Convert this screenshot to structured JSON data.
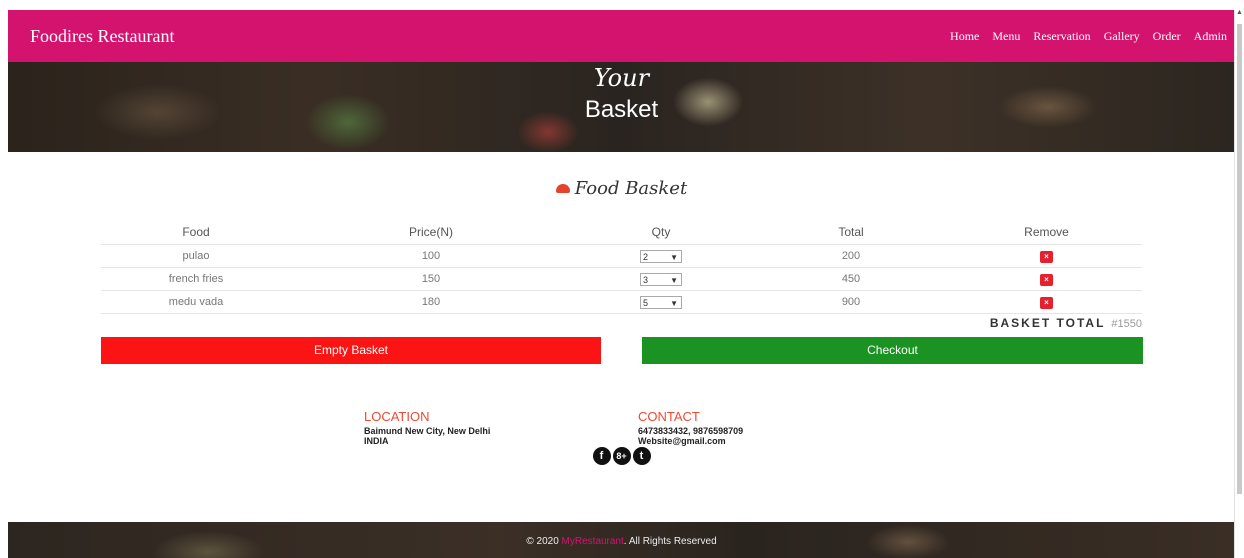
{
  "navbar": {
    "brand": "Foodires Restaurant",
    "links": [
      "Home",
      "Menu",
      "Reservation",
      "Gallery",
      "Order",
      "Admin"
    ],
    "background": "#d4136f"
  },
  "hero": {
    "line1": "Your",
    "line2": "Basket"
  },
  "basket": {
    "title": "Food Basket",
    "icon": "basket-icon",
    "headers": {
      "food": "Food",
      "price": "Price(N)",
      "qty": "Qty",
      "total": "Total",
      "remove": "Remove"
    },
    "items": [
      {
        "food": "pulao",
        "price": "100",
        "qty": "2",
        "total": "200"
      },
      {
        "food": "french fries",
        "price": "150",
        "qty": "3",
        "total": "450"
      },
      {
        "food": "medu vada",
        "price": "180",
        "qty": "5",
        "total": "900"
      }
    ],
    "remove_symbol": "×",
    "total_label": "BASKET TOTAL",
    "total_value": "#1550"
  },
  "buttons": {
    "empty": "Empty Basket",
    "checkout": "Checkout",
    "empty_color": "#fb1414",
    "checkout_color": "#1a9323"
  },
  "location": {
    "title": "LOCATION",
    "line1": "Baimund New City, New Delhi",
    "line2": "INDIA"
  },
  "contact": {
    "title": "CONTACT",
    "line1": "6473833432, 9876598709",
    "line2": "Website@gmail.com"
  },
  "social": {
    "facebook": "f",
    "google_plus": "8+",
    "twitter": "t",
    "icons": [
      "facebook-icon",
      "google-plus-icon",
      "twitter-icon"
    ]
  },
  "footer": {
    "prefix": "© 2020",
    "brand": "MyRestaurant",
    "suffix": "All Rights Reserved"
  }
}
